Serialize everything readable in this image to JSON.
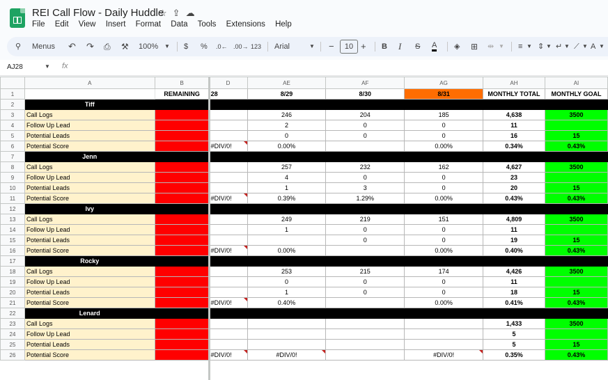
{
  "doc_title": "REI Call Flow - Daily Huddle",
  "title_icons": [
    "star-icon",
    "move-to-folder-icon",
    "cloud-status-icon"
  ],
  "menu": [
    "File",
    "Edit",
    "View",
    "Insert",
    "Format",
    "Data",
    "Tools",
    "Extensions",
    "Help"
  ],
  "toolbar": {
    "search": "Menus",
    "zoom": "100%",
    "currency": "$",
    "percent": "%",
    "dec_decrease": ".0←",
    "dec_increase": ".00→",
    "number_format": "123",
    "font": "Arial",
    "font_size": "10",
    "bold": "B",
    "italic": "I",
    "strike": "S",
    "text_color": "A",
    "text_color_bar": "#000000"
  },
  "name_box": "AJ28",
  "formula_label": "fx",
  "columns": [
    "A",
    "B",
    "D",
    "AE",
    "AF",
    "AG",
    "AH",
    "AI"
  ],
  "header_row": {
    "num": "1",
    "b": "REMAINING",
    "d": "28",
    "ae": "8/29",
    "af": "8/30",
    "ag": "8/31",
    "ah": "MONTHLY TOTAL",
    "ai": "MONTHLY GOAL"
  },
  "row_labels": {
    "call_logs": "Call Logs",
    "follow_up": "Follow Up Lead",
    "potential_leads": "Potential Leads",
    "potential_score": "Potential Score"
  },
  "colors": {
    "label_bg": "#fff2cc",
    "remaining": "#ff0000",
    "goal": "#00ff00",
    "today": "#ff6d01",
    "name_bar": "#000000"
  },
  "people": [
    {
      "name": "Tiff",
      "name_row": "2",
      "rows": [
        {
          "num": "3",
          "d": "",
          "ae": "246",
          "af": "204",
          "ag": "185",
          "ah": "4,638",
          "ai": "3500"
        },
        {
          "num": "4",
          "d": "",
          "ae": "2",
          "af": "0",
          "ag": "0",
          "ah": "11",
          "ai": ""
        },
        {
          "num": "5",
          "d": "",
          "ae": "0",
          "af": "0",
          "ag": "0",
          "ah": "16",
          "ai": "15"
        },
        {
          "num": "6",
          "d": "#DIV/0!",
          "ae": "0.00%",
          "af": "",
          "ag": "0.00%",
          "ah": "0.34%",
          "ai": "0.43%"
        }
      ]
    },
    {
      "name": "Jenn",
      "name_row": "7",
      "rows": [
        {
          "num": "8",
          "d": "",
          "ae": "257",
          "af": "232",
          "ag": "162",
          "ah": "4,627",
          "ai": "3500"
        },
        {
          "num": "9",
          "d": "",
          "ae": "4",
          "af": "0",
          "ag": "0",
          "ah": "23",
          "ai": ""
        },
        {
          "num": "10",
          "d": "",
          "ae": "1",
          "af": "3",
          "ag": "0",
          "ah": "20",
          "ai": "15"
        },
        {
          "num": "11",
          "d": "#DIV/0!",
          "ae": "0.39%",
          "af": "1.29%",
          "ag": "0.00%",
          "ah": "0.43%",
          "ai": "0.43%"
        }
      ]
    },
    {
      "name": "Ivy",
      "name_row": "12",
      "rows": [
        {
          "num": "13",
          "d": "",
          "ae": "249",
          "af": "219",
          "ag": "151",
          "ah": "4,809",
          "ai": "3500"
        },
        {
          "num": "14",
          "d": "",
          "ae": "1",
          "af": "0",
          "ag": "0",
          "ah": "11",
          "ai": ""
        },
        {
          "num": "15",
          "d": "",
          "ae": "",
          "af": "0",
          "ag": "0",
          "ah": "19",
          "ai": "15"
        },
        {
          "num": "16",
          "d": "#DIV/0!",
          "ae": "0.00%",
          "af": "",
          "ag": "0.00%",
          "ah": "0.40%",
          "ai": "0.43%"
        }
      ]
    },
    {
      "name": "Rocky",
      "name_row": "17",
      "rows": [
        {
          "num": "18",
          "d": "",
          "ae": "253",
          "af": "215",
          "ag": "174",
          "ah": "4,426",
          "ai": "3500"
        },
        {
          "num": "19",
          "d": "",
          "ae": "0",
          "af": "0",
          "ag": "0",
          "ah": "11",
          "ai": ""
        },
        {
          "num": "20",
          "d": "",
          "ae": "1",
          "af": "0",
          "ag": "0",
          "ah": "18",
          "ai": "15"
        },
        {
          "num": "21",
          "d": "#DIV/0!",
          "ae": "0.40%",
          "af": "",
          "ag": "0.00%",
          "ah": "0.41%",
          "ai": "0.43%"
        }
      ]
    },
    {
      "name": "Lenard",
      "name_row": "22",
      "rows": [
        {
          "num": "23",
          "d": "",
          "ae": "",
          "af": "",
          "ag": "",
          "ah": "1,433",
          "ai": "3500"
        },
        {
          "num": "24",
          "d": "",
          "ae": "",
          "af": "",
          "ag": "",
          "ah": "5",
          "ai": ""
        },
        {
          "num": "25",
          "d": "",
          "ae": "",
          "af": "",
          "ag": "",
          "ah": "5",
          "ai": "15"
        },
        {
          "num": "26",
          "d": "#DIV/0!",
          "ae": "#DIV/0!",
          "af": "",
          "ag": "#DIV/0!",
          "ah": "0.35%",
          "ai": "0.43%"
        }
      ]
    }
  ]
}
